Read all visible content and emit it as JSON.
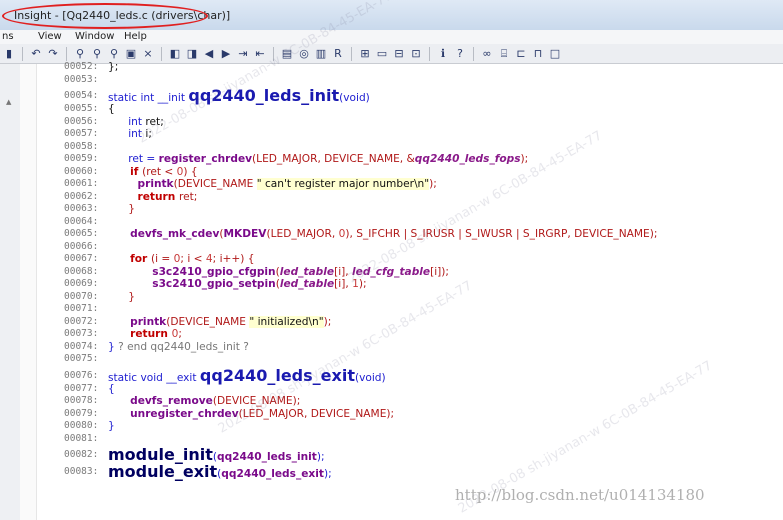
{
  "window": {
    "title": "Insight - [Qq2440_leds.c (drivers\\char)]"
  },
  "menu": [
    "ns",
    "View",
    "Window",
    "Help"
  ],
  "toolbar": {
    "icons": [
      "save-icon",
      "undo-icon",
      "redo-icon",
      "find-icon",
      "find-next-icon",
      "find-prev-icon",
      "find-files-icon",
      "xref-icon",
      "prev-icon",
      "next-icon",
      "jump-icon",
      "jump2-icon",
      "bookmark-icon",
      "project-icon",
      "browse-icon",
      "refresh-icon",
      "layout-icon",
      "panel-icon",
      "panel2-icon",
      "panel3-icon",
      "info-icon",
      "help-icon",
      "link-icon",
      "symbol-icon",
      "relation-icon",
      "tree-icon",
      "window-icon"
    ]
  },
  "code": {
    "lines": [
      {
        "n": "00052:",
        "parts": [
          {
            "t": "};",
            "c": "id"
          }
        ]
      },
      {
        "n": "00053:",
        "parts": []
      },
      {
        "n": "00054:",
        "big": true,
        "parts": [
          {
            "t": "static int __init ",
            "c": "kw"
          },
          {
            "t": "qq2440_leds_init",
            "c": "fn-def"
          },
          {
            "t": "(void)",
            "c": "kw"
          }
        ]
      },
      {
        "n": "00055:",
        "parts": [
          {
            "t": "{",
            "c": "id"
          }
        ]
      },
      {
        "n": "00056:",
        "parts": [
          {
            "t": "      int ",
            "c": "kw"
          },
          {
            "t": "ret",
            "c": "id"
          },
          {
            "t": ";",
            "c": "id"
          }
        ]
      },
      {
        "n": "00057:",
        "parts": [
          {
            "t": "      int ",
            "c": "kw"
          },
          {
            "t": "i",
            "c": "id"
          },
          {
            "t": ";",
            "c": "id"
          }
        ]
      },
      {
        "n": "00058:",
        "parts": []
      },
      {
        "n": "00059:",
        "parts": [
          {
            "t": "      ret = ",
            "c": "kw"
          },
          {
            "t": "register_chrdev",
            "c": "call"
          },
          {
            "t": "(LED_MAJOR, DEVICE_NAME, &",
            "c": "const"
          },
          {
            "t": "qq2440_leds_fops",
            "c": "ref"
          },
          {
            "t": ");",
            "c": "const"
          }
        ]
      },
      {
        "n": "00060:",
        "parts": [
          {
            "t": "      if ",
            "c": "kw2"
          },
          {
            "t": "(ret < ",
            "c": "const"
          },
          {
            "t": "0",
            "c": "num"
          },
          {
            "t": ") {",
            "c": "const"
          }
        ]
      },
      {
        "n": "00061:",
        "parts": [
          {
            "t": "        printk",
            "c": "call"
          },
          {
            "t": "(DEVICE_NAME ",
            "c": "const"
          },
          {
            "t": "\" can't register major number\\n\"",
            "c": "str"
          },
          {
            "t": ");",
            "c": "const"
          }
        ]
      },
      {
        "n": "00062:",
        "parts": [
          {
            "t": "        return ",
            "c": "kw2"
          },
          {
            "t": "ret;",
            "c": "const"
          }
        ]
      },
      {
        "n": "00063:",
        "parts": [
          {
            "t": "      }",
            "c": "const"
          }
        ]
      },
      {
        "n": "00064:",
        "parts": []
      },
      {
        "n": "00065:",
        "parts": [
          {
            "t": "      devfs_mk_cdev",
            "c": "call"
          },
          {
            "t": "(",
            "c": "const"
          },
          {
            "t": "MKDEV",
            "c": "call"
          },
          {
            "t": "(LED_MAJOR, ",
            "c": "const"
          },
          {
            "t": "0",
            "c": "num"
          },
          {
            "t": "), S_IFCHR | S_IRUSR | S_IWUSR | S_IRGRP, DEVICE_NAME);",
            "c": "const"
          }
        ]
      },
      {
        "n": "00066:",
        "parts": []
      },
      {
        "n": "00067:",
        "parts": [
          {
            "t": "      for ",
            "c": "kw2"
          },
          {
            "t": "(i = ",
            "c": "const"
          },
          {
            "t": "0",
            "c": "num"
          },
          {
            "t": "; i < ",
            "c": "const"
          },
          {
            "t": "4",
            "c": "num"
          },
          {
            "t": "; i++) {",
            "c": "const"
          }
        ]
      },
      {
        "n": "00068:",
        "parts": [
          {
            "t": "            s3c2410_gpio_cfgpin",
            "c": "call"
          },
          {
            "t": "(",
            "c": "const"
          },
          {
            "t": "led_table",
            "c": "ref"
          },
          {
            "t": "[i], ",
            "c": "const"
          },
          {
            "t": "led_cfg_table",
            "c": "ref"
          },
          {
            "t": "[i]);",
            "c": "const"
          }
        ]
      },
      {
        "n": "00069:",
        "parts": [
          {
            "t": "            s3c2410_gpio_setpin",
            "c": "call"
          },
          {
            "t": "(",
            "c": "const"
          },
          {
            "t": "led_table",
            "c": "ref"
          },
          {
            "t": "[i], ",
            "c": "const"
          },
          {
            "t": "1",
            "c": "num"
          },
          {
            "t": ");",
            "c": "const"
          }
        ]
      },
      {
        "n": "00070:",
        "parts": [
          {
            "t": "      }",
            "c": "const"
          }
        ]
      },
      {
        "n": "00071:",
        "parts": []
      },
      {
        "n": "00072:",
        "parts": [
          {
            "t": "      printk",
            "c": "call"
          },
          {
            "t": "(DEVICE_NAME ",
            "c": "const"
          },
          {
            "t": "\" initialized\\n\"",
            "c": "str"
          },
          {
            "t": ");",
            "c": "const"
          }
        ]
      },
      {
        "n": "00073:",
        "parts": [
          {
            "t": "      return ",
            "c": "kw2"
          },
          {
            "t": "0",
            "c": "num"
          },
          {
            "t": ";",
            "c": "const"
          }
        ]
      },
      {
        "n": "00074:",
        "parts": [
          {
            "t": "} ",
            "c": "kw"
          },
          {
            "t": "? end qq2440_leds_init ?",
            "c": "comment"
          }
        ]
      },
      {
        "n": "00075:",
        "parts": []
      },
      {
        "n": "00076:",
        "big": true,
        "parts": [
          {
            "t": "static void __exit ",
            "c": "kw"
          },
          {
            "t": "qq2440_leds_exit",
            "c": "fn-def"
          },
          {
            "t": "(void)",
            "c": "kw"
          }
        ]
      },
      {
        "n": "00077:",
        "parts": [
          {
            "t": "{",
            "c": "kw"
          }
        ]
      },
      {
        "n": "00078:",
        "parts": [
          {
            "t": "      devfs_remove",
            "c": "call"
          },
          {
            "t": "(DEVICE_NAME);",
            "c": "const"
          }
        ]
      },
      {
        "n": "00079:",
        "parts": [
          {
            "t": "      unregister_chrdev",
            "c": "call"
          },
          {
            "t": "(LED_MAJOR, DEVICE_NAME);",
            "c": "const"
          }
        ]
      },
      {
        "n": "00080:",
        "parts": [
          {
            "t": "}",
            "c": "kw"
          }
        ]
      },
      {
        "n": "00081:",
        "parts": []
      },
      {
        "n": "00082:",
        "big": true,
        "parts": [
          {
            "t": "module_init",
            "c": "fn-def2"
          },
          {
            "t": "(",
            "c": "kw"
          },
          {
            "t": "qq2440_leds_init",
            "c": "call"
          },
          {
            "t": ");",
            "c": "kw"
          }
        ]
      },
      {
        "n": "00083:",
        "big": true,
        "parts": [
          {
            "t": "module_exit",
            "c": "fn-def2"
          },
          {
            "t": "(",
            "c": "kw"
          },
          {
            "t": "qq2440_leds_exit",
            "c": "call"
          },
          {
            "t": ");",
            "c": "kw"
          }
        ]
      }
    ]
  },
  "watermarks": [
    "2022-08-08 sh-jiyanan-w 6C-0B-84-45-EA-77"
  ],
  "footer": {
    "url": "http://blog.csdn.net/u014134180"
  },
  "colors": {
    "keyword": "#1c1cd0",
    "control": "#c00000",
    "call": "#7a0a8a",
    "highlight": "#ffffd0",
    "oval": "#e02020"
  }
}
